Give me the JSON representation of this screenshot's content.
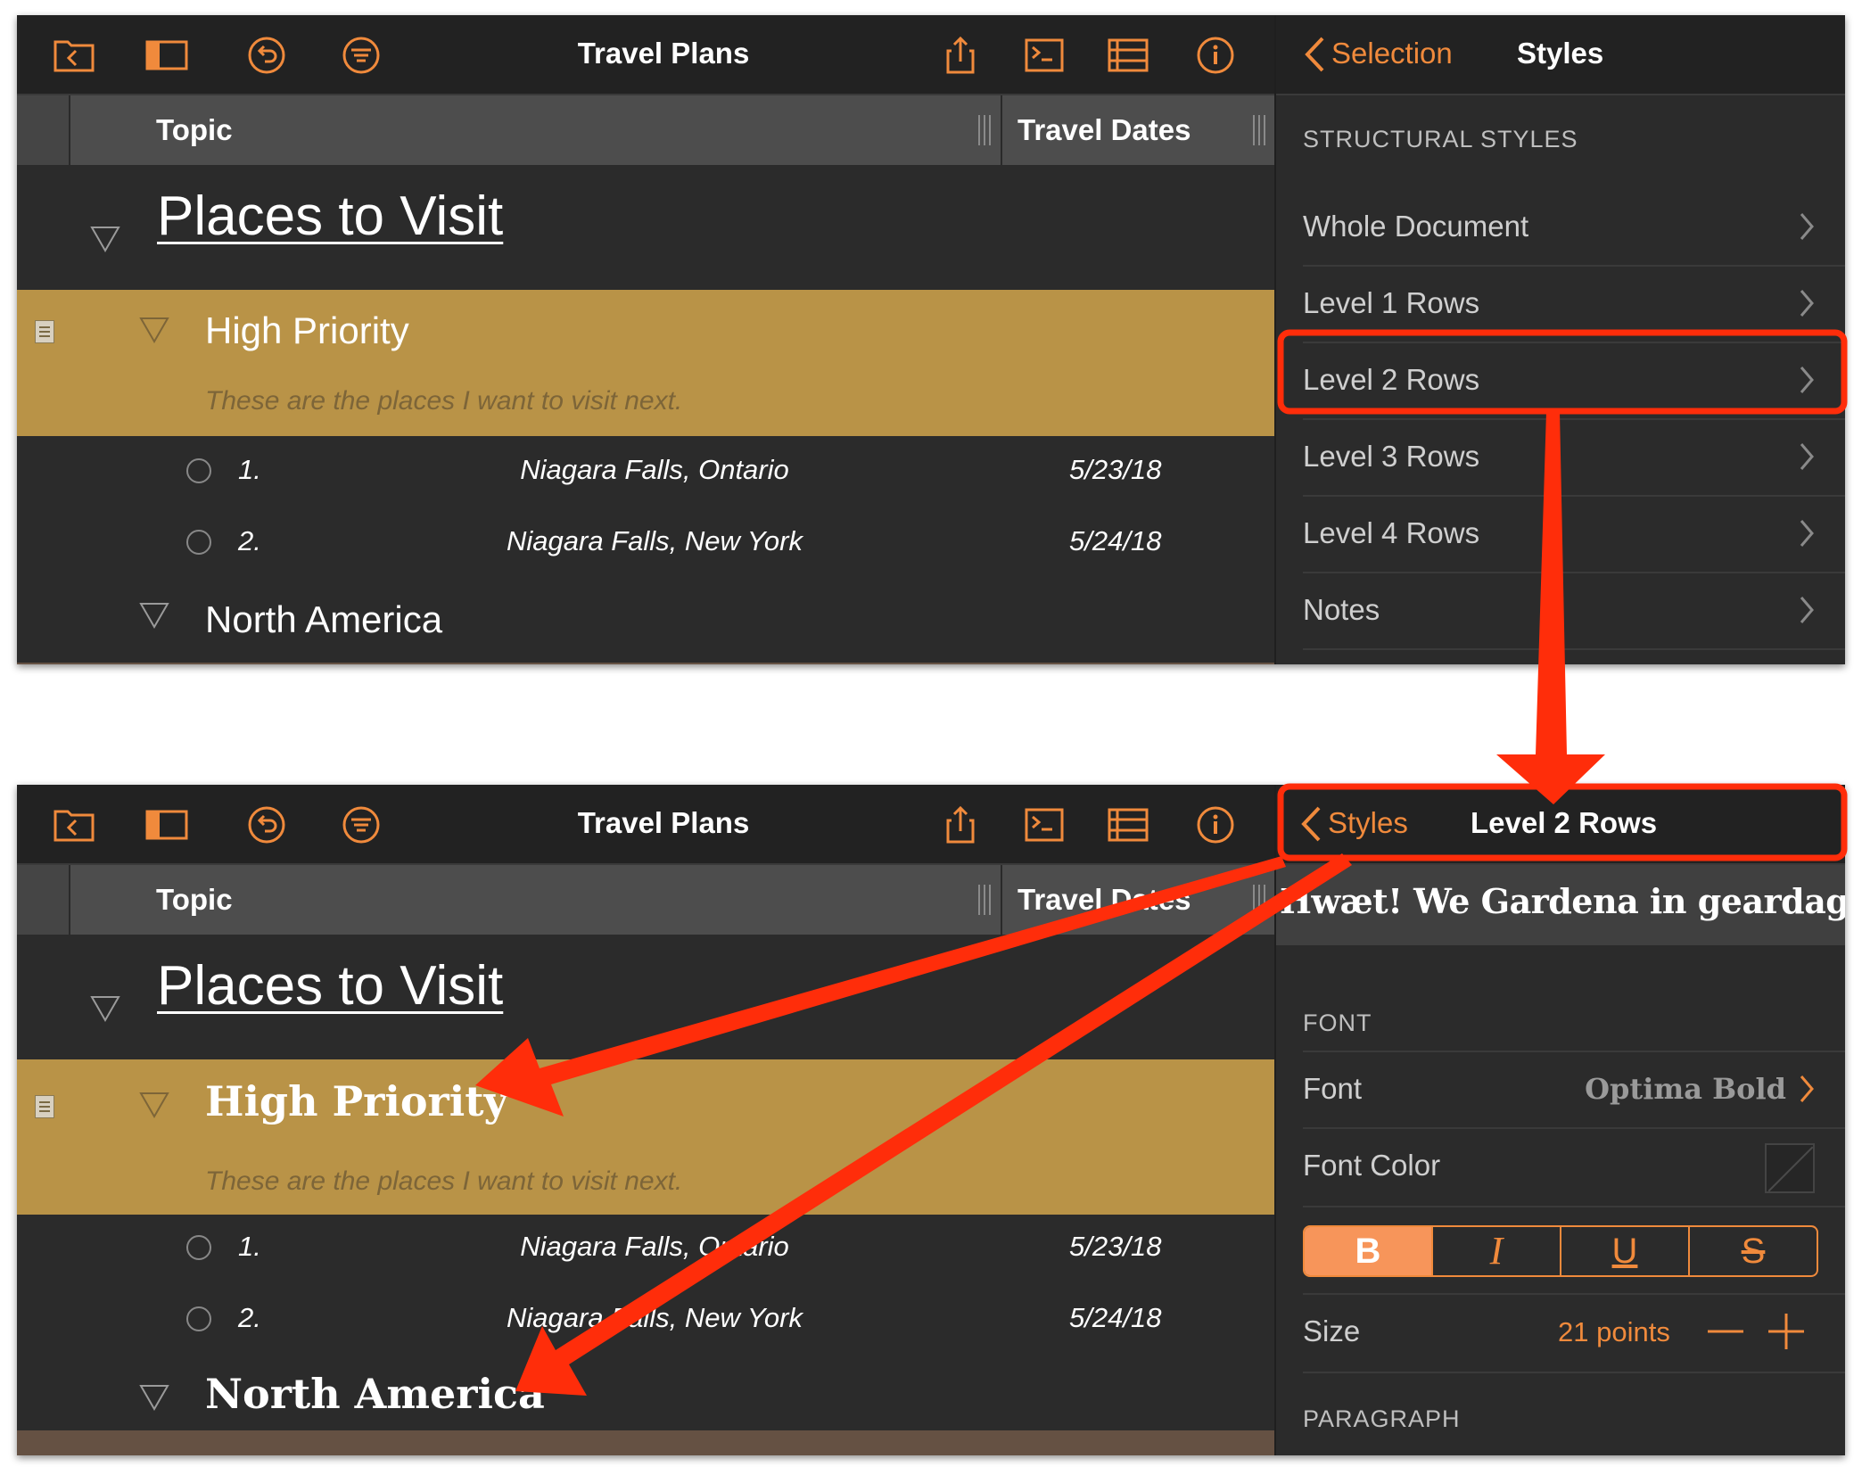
{
  "app": {
    "window_title": "Travel Plans",
    "toolbar_icons": [
      "documents-icon",
      "sidebar-icon",
      "undo-icon",
      "filter-icon",
      "share-icon",
      "terminal-icon",
      "columns-icon",
      "info-icon"
    ]
  },
  "outline": {
    "columns": {
      "topic": "Topic",
      "dates": "Travel Dates"
    },
    "level1": "Places to Visit",
    "high_priority": {
      "title": "High Priority",
      "note": "These are the places I want to visit next."
    },
    "items": [
      {
        "num": "1.",
        "place": "Niagara Falls, Ontario",
        "date": "5/23/18"
      },
      {
        "num": "2.",
        "place": "Niagara Falls, New York",
        "date": "5/24/18"
      }
    ],
    "north_america": "North America"
  },
  "inspector_top": {
    "back": "Selection",
    "title": "Styles",
    "section": "STRUCTURAL STYLES",
    "rows": [
      "Whole Document",
      "Level 1 Rows",
      "Level 2 Rows",
      "Level 3 Rows",
      "Level 4 Rows",
      "Notes"
    ]
  },
  "inspector_bottom": {
    "back": "Styles",
    "title": "Level 2 Rows",
    "preview": "Hwæt! We Gardena in geardagum",
    "font_section": "FONT",
    "font_label": "Font",
    "font_value": "Optima Bold",
    "font_color_label": "Font Color",
    "format_buttons": {
      "bold": "B",
      "italic": "I",
      "underline": "U",
      "strike": "S"
    },
    "size_label": "Size",
    "size_value": "21 points",
    "paragraph_section": "PARAGRAPH"
  },
  "colors": {
    "accent": "#f08a3c",
    "highlight_row": "#b99347",
    "annotation_red": "#ff2d0a"
  }
}
